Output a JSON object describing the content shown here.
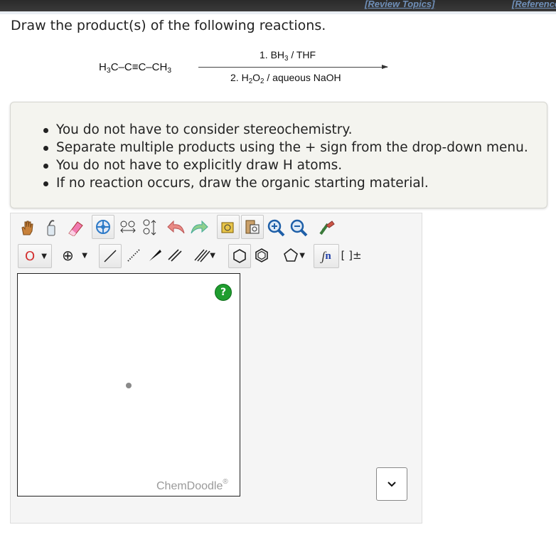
{
  "header": {
    "review_topics": "[Review Topics]",
    "references": "[References]"
  },
  "question": {
    "prompt": "Draw the product(s) of the following reactions."
  },
  "reaction": {
    "reactant_html": "H<sub>3</sub>C–C≡C–CH<sub>3</sub>",
    "step1_html": "1. BH<sub>3</sub> / THF",
    "step2_html": "2. H<sub>2</sub>O<sub>2</sub> / aqueous NaOH"
  },
  "instructions": [
    "You do not have to consider stereochemistry.",
    "Separate multiple products using the + sign from the drop-down menu.",
    "You do not have to explicitly draw H atoms.",
    "If no reaction occurs, draw the organic starting material."
  ],
  "editor": {
    "atom_label": "O",
    "charge_symbol": "⊕",
    "sgroup_label": "n",
    "bracket_label": "[ ]±",
    "help_label": "?",
    "brand": "ChemDoodle",
    "brand_mark": "®"
  },
  "colors": {
    "help_green": "#1f9d2f",
    "atom_red": "#d32f2f",
    "link_blue": "#6f8fb8"
  }
}
